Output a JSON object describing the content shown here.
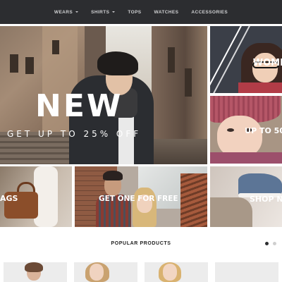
{
  "nav": {
    "items": [
      {
        "label": "WEARS",
        "has_dropdown": true
      },
      {
        "label": "SHIRTS",
        "has_dropdown": true
      },
      {
        "label": "TOPS",
        "has_dropdown": false
      },
      {
        "label": "WATCHES",
        "has_dropdown": false
      },
      {
        "label": "ACCESSORIES",
        "has_dropdown": false
      }
    ]
  },
  "hero": {
    "title": "NEW",
    "subtitle": "GET UP TO 25% OFF",
    "slide_count": 2
  },
  "promos": {
    "women": {
      "label": "WOME"
    },
    "hats": {
      "label": "UP TO 50"
    },
    "bags": {
      "label": "AGS"
    },
    "couple": {
      "label": "GET ONE FOR FREE"
    },
    "shoes": {
      "label": "SHOP N"
    }
  },
  "popular": {
    "title": "POPULAR PRODUCTS",
    "page_count": 2,
    "active_page": 1,
    "product_count": 4
  },
  "colors": {
    "nav_bg": "#2c2d30",
    "nav_text": "#cfd0d2",
    "page_bg": "#ffffff",
    "promo_text": "#ffffff"
  }
}
